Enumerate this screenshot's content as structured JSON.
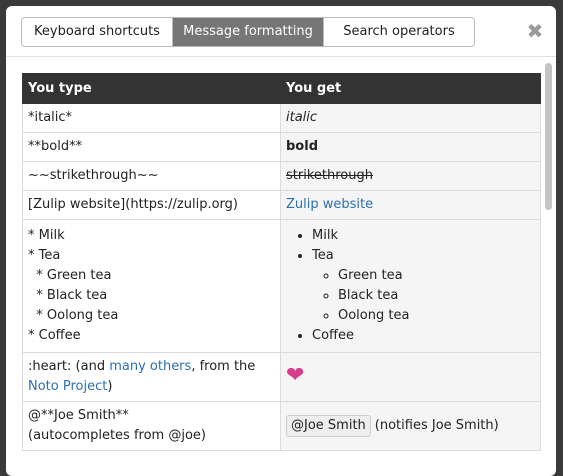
{
  "tabs": [
    "Keyboard shortcuts",
    "Message formatting",
    "Search operators"
  ],
  "active_tab": "Message formatting",
  "close_glyph": "✖",
  "table": {
    "headers": [
      "You type",
      "You get"
    ],
    "rows": {
      "italic": {
        "type": "*italic*",
        "get": "italic"
      },
      "bold": {
        "type": "**bold**",
        "get": "bold"
      },
      "strike": {
        "type": "~~strikethrough~~",
        "get": "strikethrough"
      },
      "link": {
        "type": "[Zulip website](https://zulip.org)",
        "get": "Zulip website"
      },
      "list": {
        "type_lines": [
          "* Milk",
          "* Tea",
          "  * Green tea",
          "  * Black tea",
          "  * Oolong tea",
          "* Coffee"
        ],
        "get_items": [
          "Milk",
          "Tea",
          "Coffee"
        ],
        "get_subitems": [
          "Green tea",
          "Black tea",
          "Oolong tea"
        ]
      },
      "emoji": {
        "type_prefix": ":heart: (and ",
        "link1": "many others",
        "middle": ", from the ",
        "link2": "Noto Project",
        "suffix": ")",
        "get_icon": "heart-emoji"
      },
      "mention": {
        "type_line1": "@**Joe Smith**",
        "type_line2": "(autocompletes from @joe)",
        "pill": "@Joe Smith",
        "note": "(notifies Joe Smith)"
      }
    }
  },
  "colors": {
    "header_bg": "#333333",
    "active_tab_bg": "#767676",
    "link": "#2c6fb0",
    "heart": "#d63d8c"
  }
}
